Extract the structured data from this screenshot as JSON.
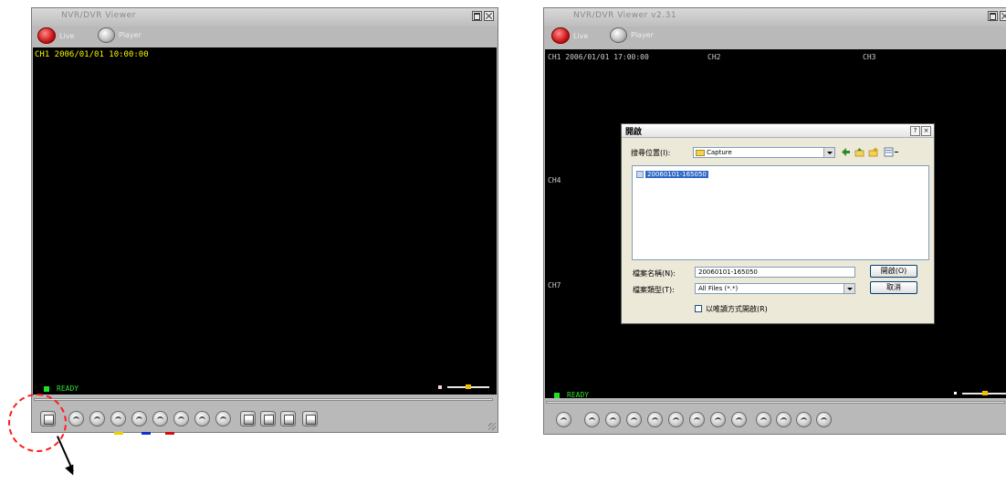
{
  "left_window": {
    "title": "NVR/DVR Viewer",
    "modes": {
      "live": "Live",
      "player": "Player"
    },
    "osd": "CH1 2006/01/01 10:00:00",
    "status": "READY",
    "seek_position": 0.0
  },
  "right_window": {
    "title": "NVR/DVR Viewer v2.31",
    "modes": {
      "live": "Live",
      "player": "Player"
    },
    "osd": {
      "ch1": "CH1 2006/01/01 17:00:00",
      "ch2": "CH2",
      "ch3": "CH3",
      "ch4": "CH4",
      "ch7": "CH7"
    },
    "status": "READY",
    "seek_position": 0.0
  },
  "open_dialog": {
    "title": "開啟",
    "look_in_label": "搜尋位置(I):",
    "look_in_value": "Capture",
    "files": [
      "20060101-165050"
    ],
    "filename_label": "檔案名稱(N):",
    "filename_value": "20060101-165050",
    "filetype_label": "檔案類型(T):",
    "filetype_value": "All Files (*.*)",
    "open_button": "開啟(O)",
    "cancel_button": "取消",
    "readonly_label": "以唯讀方式開啟(R)"
  },
  "colors": {
    "osd_yellow": "#f5f500",
    "status_green": "#2fe02f",
    "callout_red": "#ff1a1a"
  }
}
